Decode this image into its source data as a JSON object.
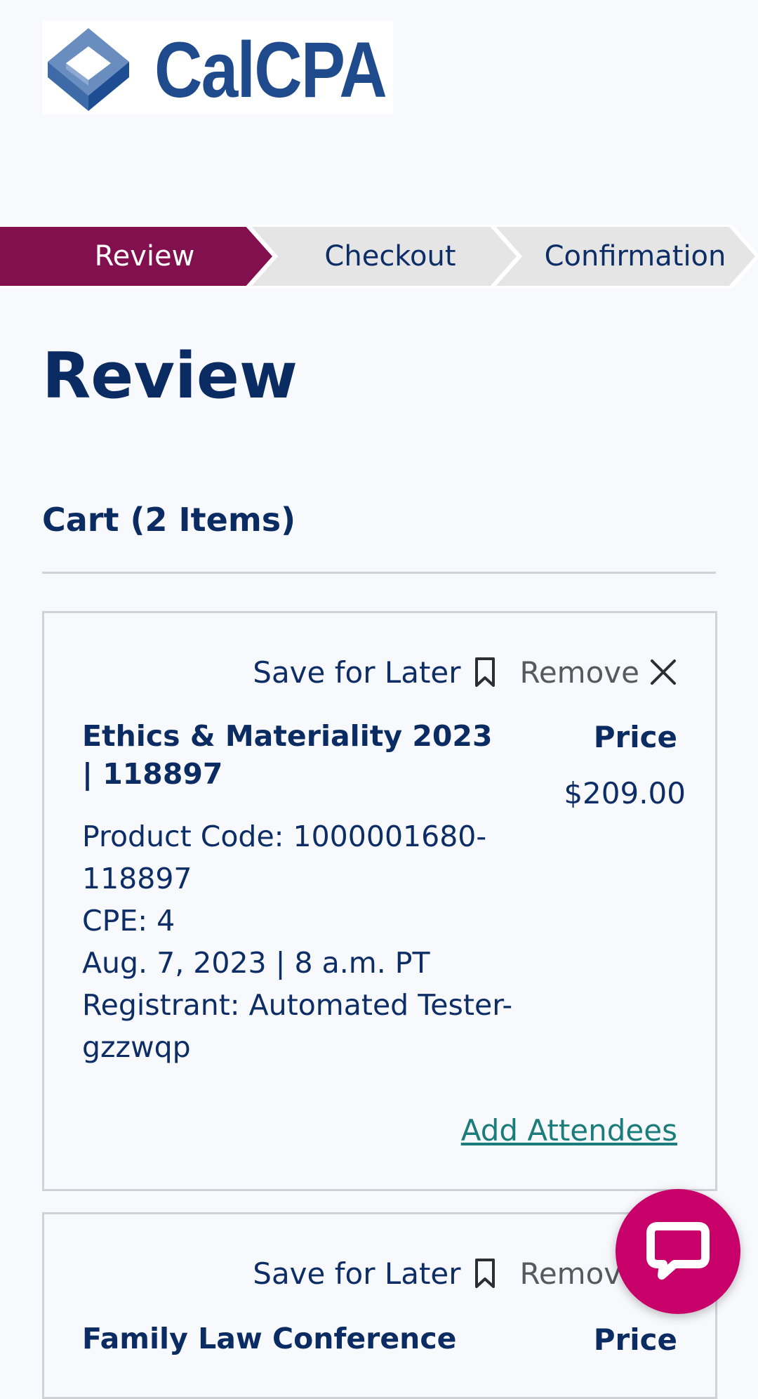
{
  "brand": {
    "logo_text": "CalCPA"
  },
  "steps": [
    {
      "label": "Review",
      "active": true
    },
    {
      "label": "Checkout",
      "active": false
    },
    {
      "label": "Confirmation",
      "active": false
    }
  ],
  "page_title": "Review",
  "cart": {
    "heading": "Cart (2 Items)",
    "save_label": "Save for Later",
    "remove_label": "Remove",
    "price_label": "Price",
    "items": [
      {
        "title": "Ethics & Materiality 2023 | 118897",
        "product_code": "Product Code: 1000001680-118897",
        "cpe": "CPE: 4",
        "date": "Aug. 7, 2023 | 8 a.m. PT",
        "registrant": "Registrant: Automated Tester-gzzwqp",
        "price": "$209.00",
        "add_attendees": "Add Attendees"
      },
      {
        "title": "Family Law Conference"
      }
    ]
  },
  "colors": {
    "active_step": "#82104f",
    "inactive_step": "#e5e5e5",
    "heading": "#0b2b63",
    "link": "#1a7d7b",
    "chat_button": "#c8006a"
  },
  "icons": {
    "save": "bookmark-icon",
    "remove": "close-icon",
    "chat": "chat-bubble-icon",
    "logo": "calcpa-cube-logo"
  }
}
